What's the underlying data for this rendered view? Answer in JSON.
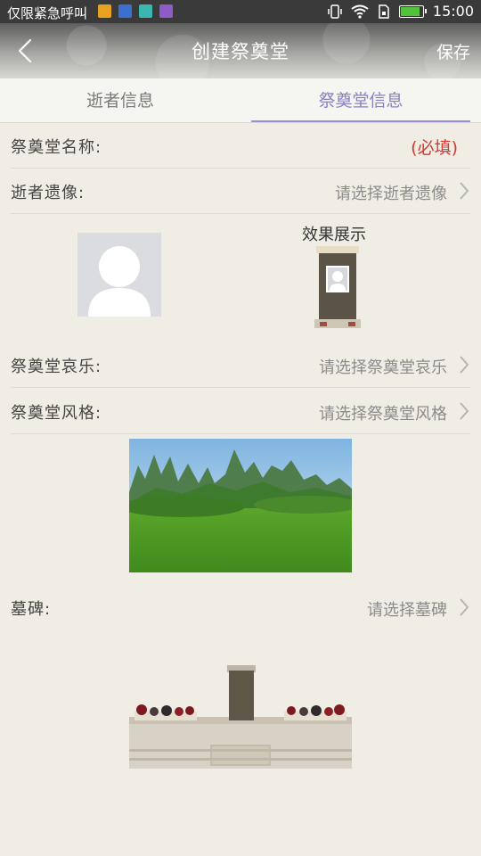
{
  "status_bar": {
    "carrier": "仅限紧急呼叫",
    "time": "15:00",
    "app_icon_colors": [
      "#e9a21f",
      "#3b6fd1",
      "#3cb7b0",
      "#8d5cc9"
    ],
    "icons": [
      "vibrate-icon",
      "wifi-icon",
      "sim-icon",
      "battery-icon"
    ]
  },
  "header": {
    "title": "创建祭奠堂",
    "save_label": "保存",
    "back_icon": "chevron-left-icon"
  },
  "tabs": [
    {
      "label": "逝者信息",
      "active": false
    },
    {
      "label": "祭奠堂信息",
      "active": true
    }
  ],
  "form": {
    "hall_name": {
      "label": "祭奠堂名称:",
      "required": "(必填)"
    },
    "portrait": {
      "label": "逝者遗像:",
      "placeholder": "请选择逝者遗像",
      "preview_label": "效果展示"
    },
    "music": {
      "label": "祭奠堂哀乐:",
      "placeholder": "请选择祭奠堂哀乐"
    },
    "style": {
      "label": "祭奠堂风格:",
      "placeholder": "请选择祭奠堂风格"
    },
    "tombstone": {
      "label": "墓碑:",
      "placeholder": "请选择墓碑"
    }
  },
  "colors": {
    "accent": "#8b7fc1",
    "required": "#d8362e",
    "background": "#efede4"
  }
}
